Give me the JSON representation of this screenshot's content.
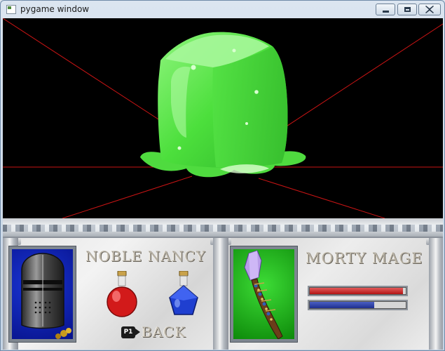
{
  "window": {
    "title": "pygame window"
  },
  "colors": {
    "scene_background": "#000000",
    "scene_lines": "#c81414",
    "slime": "#4cdf3c",
    "hp_bar": "#c62020",
    "mp_bar": "#2b3fa8",
    "knight_portrait_bg": "#0a1ab0",
    "mage_portrait_bg": "#19b414"
  },
  "scene": {
    "enemy_icon": "green-slime-cube-icon"
  },
  "party": {
    "hero1": {
      "name": "NOBLE NANCY",
      "portrait_icon": "knight-helmet-icon",
      "items": [
        "red-potion-icon",
        "blue-potion-icon"
      ]
    },
    "hero2": {
      "name": "MORTY MAGE",
      "portrait_icon": "crystal-staff-icon",
      "hp_fraction": 0.97,
      "mp_fraction": 0.67
    }
  },
  "menu": {
    "back_icon_text": "P1",
    "back_label": "BACK"
  }
}
